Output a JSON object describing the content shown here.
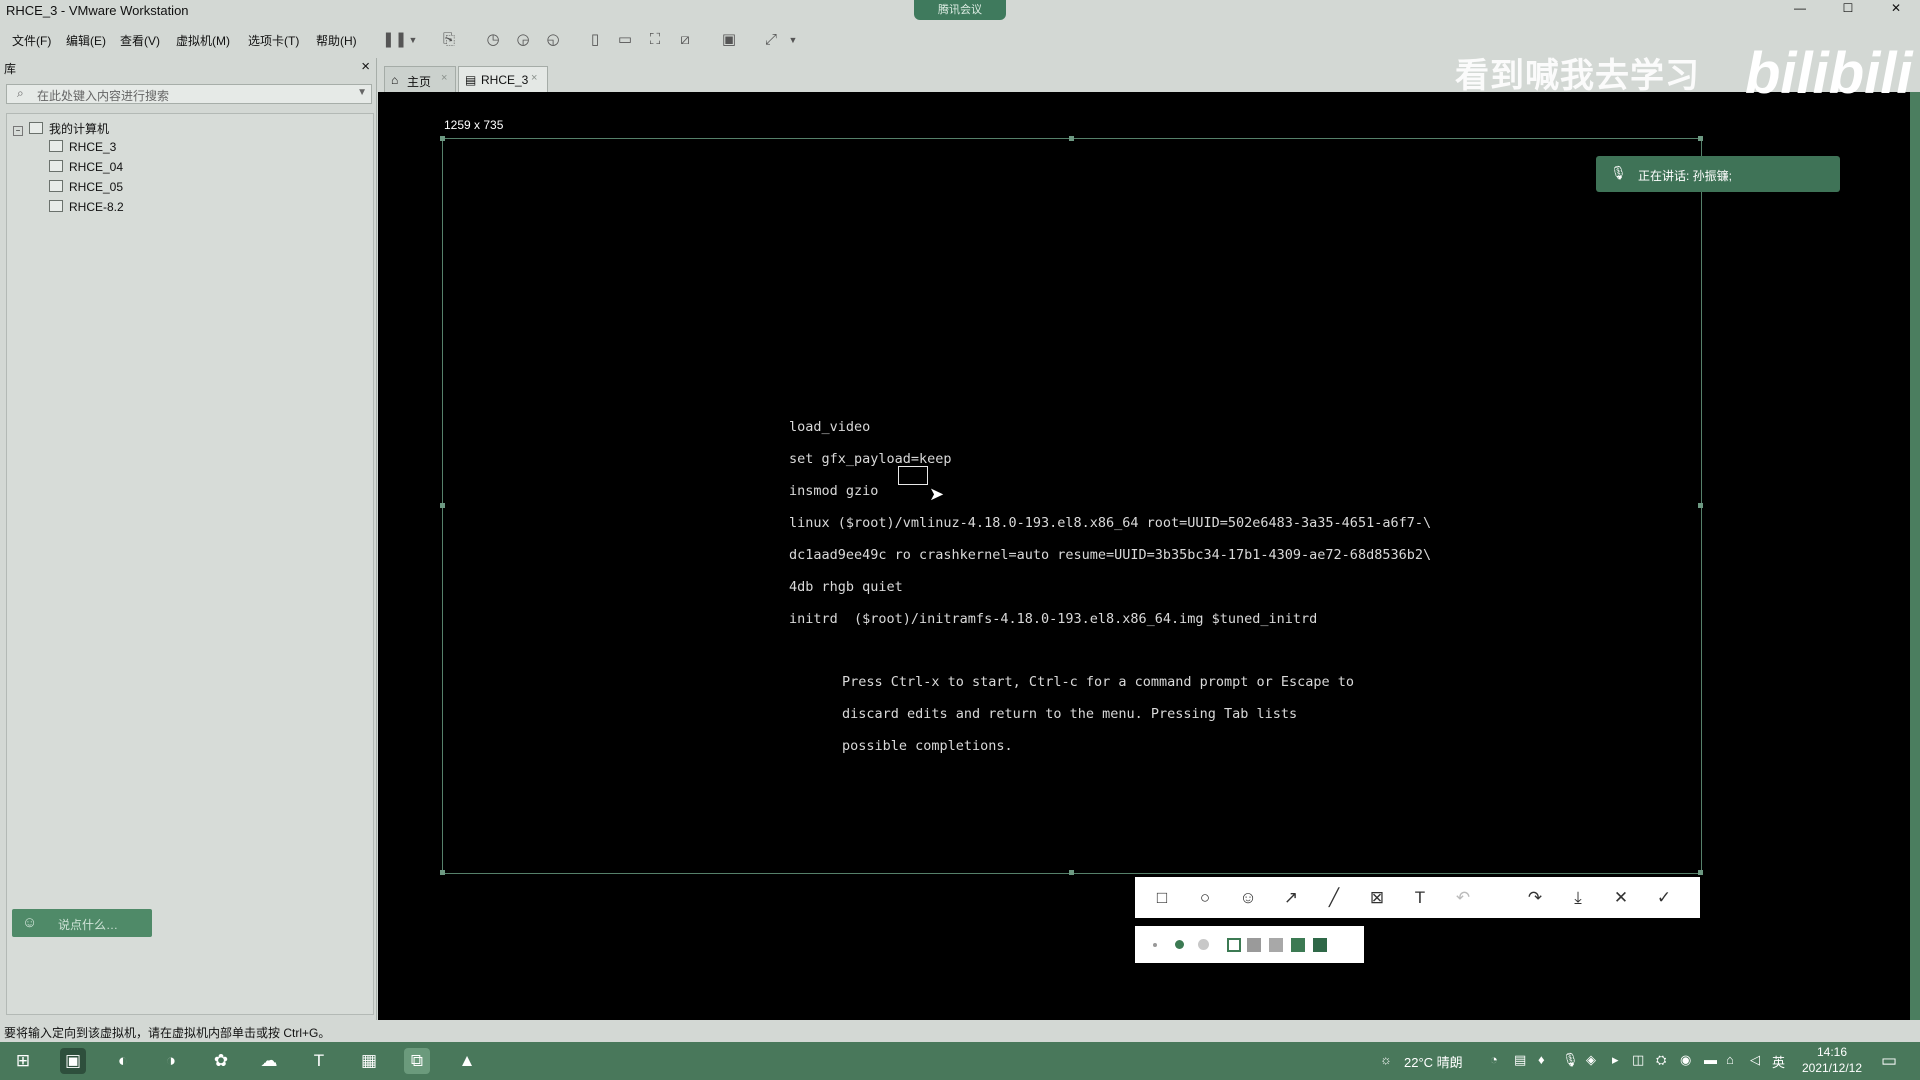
{
  "window": {
    "title": "RHCE_3 - VMware Workstation",
    "meeting_pill": "腾讯会议",
    "min": "—",
    "max": "☐",
    "close": "✕"
  },
  "menu": [
    "文件(F)",
    "编辑(E)",
    "查看(V)",
    "虚拟机(M)",
    "选项卡(T)",
    "帮助(H)"
  ],
  "library": {
    "header": "库",
    "close": "×",
    "search_placeholder": "在此处键入内容进行搜索",
    "tree_root": "我的计算机",
    "items": [
      "RHCE_3",
      "RHCE_04",
      "RHCE_05",
      "RHCE-8.2"
    ],
    "say_placeholder": "说点什么…"
  },
  "tabs": [
    {
      "label": "主页",
      "active": false
    },
    {
      "label": "RHCE_3",
      "active": true
    }
  ],
  "vm": {
    "selection_size": "1259 x 735",
    "grub_lines": [
      "load_video",
      "set gfx_payload=keep",
      "insmod gzio",
      "linux ($root)/vmlinuz-4.18.0-193.el8.x86_64 root=UUID=502e6483-3a35-4651-a6f7-\\",
      "dc1aad9ee49c ro crashkernel=auto resume=UUID=3b35bc34-17b1-4309-ae72-68d8536b2\\",
      "4db rhgb quiet",
      "initrd  ($root)/initramfs-4.18.0-193.el8.x86_64.img $tuned_initrd"
    ],
    "help_lines": [
      "Press Ctrl-x to start, Ctrl-c for a command prompt or Escape to",
      "discard edits and return to the menu. Pressing Tab lists",
      "possible completions."
    ]
  },
  "speaking": "正在讲话: 孙振镰;",
  "watermark": "看到喊我去学习",
  "bili_logo": "bilibili",
  "annotation_colors": [
    "#ffffff",
    "#9a9a9a",
    "#a8a8a8",
    "#3c7a53",
    "#2f6848"
  ],
  "statusbar": "要将输入定向到该虚拟机，请在虚拟机内部单击或按 Ctrl+G。",
  "taskbar": {
    "weather": "22°C 晴朗",
    "ime": "英",
    "time": "14:16",
    "date": "2021/12/12"
  },
  "colors": {
    "chrome_bg": "#d3d8d4",
    "accent_green": "#49785b",
    "vm_bg": "#000000"
  }
}
